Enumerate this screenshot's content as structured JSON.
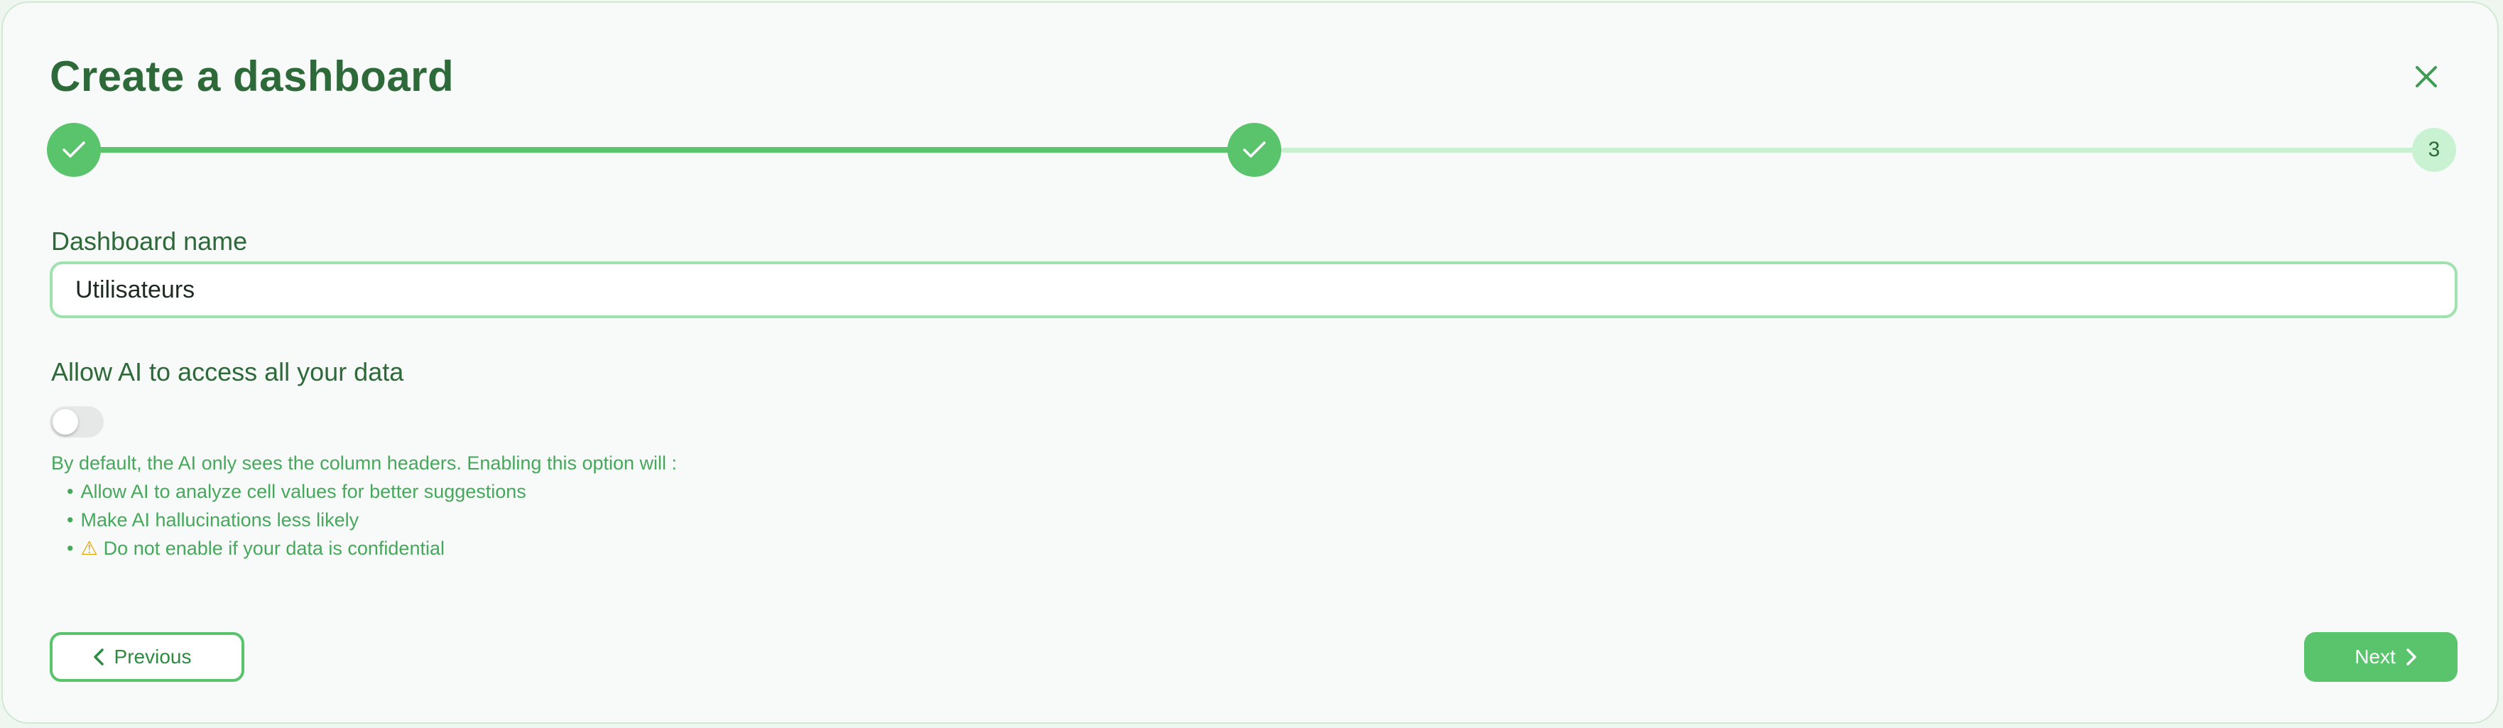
{
  "dialog": {
    "title": "Create a dashboard",
    "close_icon": "close-icon"
  },
  "stepper": {
    "steps": [
      {
        "state": "complete",
        "icon": "check-icon"
      },
      {
        "state": "complete",
        "icon": "check-icon"
      },
      {
        "state": "pending",
        "label": "3"
      }
    ]
  },
  "form": {
    "name_label": "Dashboard name",
    "name_value": "Utilisateurs",
    "ai_label": "Allow AI to access all your data",
    "ai_enabled": false,
    "help_intro": "By default, the AI only sees the column headers. Enabling this option will :",
    "help_items": [
      "Allow AI to analyze cell values for better suggestions",
      "Make AI hallucinations less likely",
      "Do not enable if your data is confidential"
    ],
    "warning_icon": "warning-icon"
  },
  "footer": {
    "previous_label": "Previous",
    "next_label": "Next"
  },
  "colors": {
    "accent": "#5ac46d",
    "title": "#2e6a39",
    "help_text": "#45a85a",
    "pending_step": "#c9f2d2"
  }
}
